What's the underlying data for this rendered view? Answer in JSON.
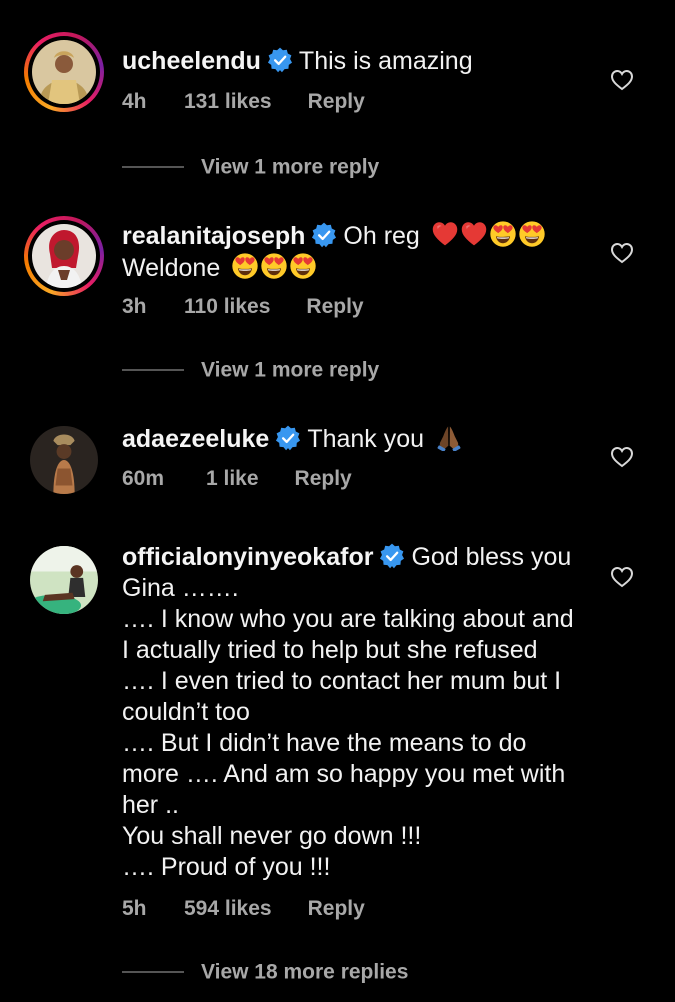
{
  "comments": [
    {
      "username": "ucheelendu",
      "lines": [
        "This is amazing"
      ],
      "time": "4h",
      "likes": "131 likes",
      "reply": "Reply",
      "view_replies": "View 1 more reply"
    },
    {
      "username": "realanitajoseph",
      "line1": "Oh reg",
      "line2": "Weldone",
      "line1_emojis": [
        "red-heart",
        "red-heart",
        "heart-eyes",
        "heart-eyes"
      ],
      "line2_emojis": [
        "heart-eyes",
        "heart-eyes",
        "heart-eyes"
      ],
      "time": "3h",
      "likes": "110 likes",
      "reply": "Reply",
      "view_replies": "View 1 more reply"
    },
    {
      "username": "adaezeeluke",
      "text": "Thank you",
      "emoji": "folded-hands",
      "time": "60m",
      "likes": "1 like",
      "reply": "Reply"
    },
    {
      "username": "officialonyinyeokafor",
      "text_first": "God bless you",
      "lines": [
        "Gina …….",
        "…. I know who you are talking about and",
        "I actually tried to help but she refused",
        "…. I even tried to contact her mum but I",
        "couldn’t too",
        "…. But I didn’t have the means to do",
        "more …. And am so happy you met with",
        "her ..",
        "You shall never go down !!!",
        "…. Proud of you !!!"
      ],
      "time": "5h",
      "likes": "594 likes",
      "reply": "Reply",
      "view_replies": "View 18 more replies"
    }
  ],
  "colors": {
    "background": "#000000",
    "text": "#f2f2f2",
    "meta": "#a8a8a8",
    "verified": "#3897f0"
  }
}
